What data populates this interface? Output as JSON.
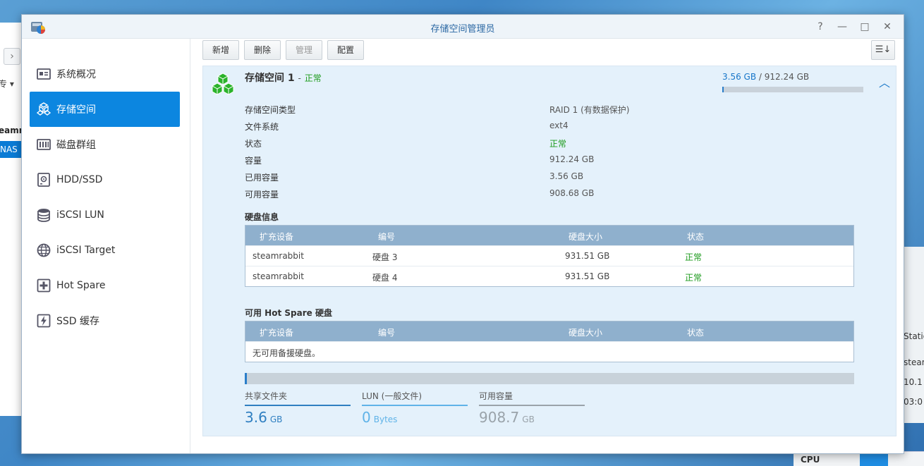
{
  "window": {
    "title": "存储空间管理员",
    "controls": [
      "?",
      "—",
      "□",
      "✕"
    ]
  },
  "background": {
    "left_fragments": [
      "专 ▾",
      "eamr",
      "NAS"
    ],
    "right_fragments": [
      "Statio",
      "steam",
      "10.1",
      "03:0"
    ],
    "widget_label": "CPU"
  },
  "sidebar": {
    "items": [
      {
        "label": "系统概况",
        "icon": "overview-icon",
        "active": false
      },
      {
        "label": "存储空间",
        "icon": "volume-icon",
        "active": true
      },
      {
        "label": "磁盘群组",
        "icon": "disk-group-icon",
        "active": false
      },
      {
        "label": "HDD/SSD",
        "icon": "hdd-icon",
        "active": false
      },
      {
        "label": "iSCSI LUN",
        "icon": "lun-icon",
        "active": false
      },
      {
        "label": "iSCSI Target",
        "icon": "target-icon",
        "active": false
      },
      {
        "label": "Hot Spare",
        "icon": "hot-spare-icon",
        "active": false
      },
      {
        "label": "SSD 缓存",
        "icon": "ssd-cache-icon",
        "active": false
      }
    ]
  },
  "toolbar": {
    "new_label": "新增",
    "delete_label": "删除",
    "manage_label": "管理",
    "config_label": "配置",
    "sort_label": "☰↓"
  },
  "volume": {
    "name": "存储空间 1",
    "separator": "-",
    "status": "正常",
    "used": "3.56 GB",
    "slash": "/",
    "total": "912.24 GB",
    "usage_fraction": 0.0039,
    "properties": [
      {
        "key": "存储空间类型",
        "value": "RAID 1 (有数据保护)",
        "ok": false
      },
      {
        "key": "文件系统",
        "value": "ext4",
        "ok": false
      },
      {
        "key": "状态",
        "value": "正常",
        "ok": true
      },
      {
        "key": "容量",
        "value": "912.24 GB",
        "ok": false
      },
      {
        "key": "已用容量",
        "value": "3.56 GB",
        "ok": false
      },
      {
        "key": "可用容量",
        "value": "908.68 GB",
        "ok": false
      }
    ]
  },
  "disk_info": {
    "title": "硬盘信息",
    "headers": [
      "扩充设备",
      "编号",
      "硬盘大小",
      "状态"
    ],
    "rows": [
      {
        "device": "steamrabbit",
        "id": "硬盘 3",
        "size": "931.51 GB",
        "status": "正常"
      },
      {
        "device": "steamrabbit",
        "id": "硬盘 4",
        "size": "931.51 GB",
        "status": "正常"
      }
    ]
  },
  "hot_spare": {
    "title": "可用 Hot Spare 硬盘",
    "headers": [
      "扩充设备",
      "编号",
      "硬盘大小",
      "状态"
    ],
    "empty_text": "无可用备援硬盘。"
  },
  "stats": [
    {
      "label": "共享文件夹",
      "value": "3.6",
      "unit": "GB",
      "color": "#2f7fc1"
    },
    {
      "label": "LUN (一般文件)",
      "value": "0",
      "unit": "Bytes",
      "color": "#5fb3e8"
    },
    {
      "label": "可用容量",
      "value": "908.7",
      "unit": "GB",
      "color": "#9aa3aa"
    }
  ]
}
